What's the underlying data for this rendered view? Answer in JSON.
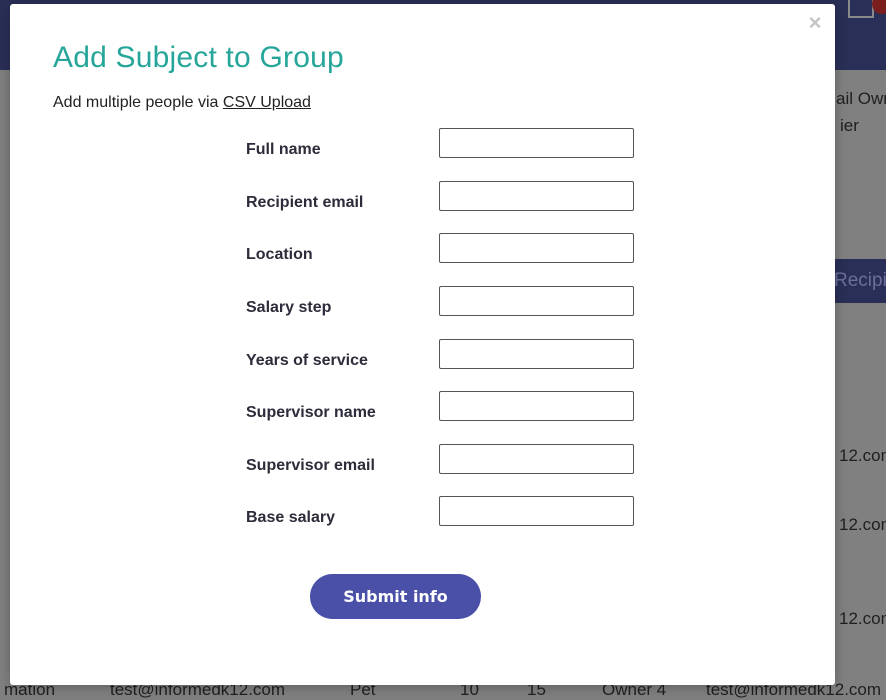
{
  "background": {
    "text_1": "ail Own",
    "text_2": "ier",
    "band_text": "Recipi",
    "text_3": "12.com",
    "text_4": "12.com",
    "text_5": "12.com",
    "row_cells": [
      "mation",
      "test@informedk12.com",
      "Pet",
      "10",
      "15",
      "Owner 4",
      "test@informedk12.com"
    ]
  },
  "modal": {
    "close_label": "×",
    "title": "Add Subject to Group",
    "subtitle_prefix": "Add multiple people via ",
    "csv_link": "CSV Upload",
    "fields": [
      {
        "label": "Full name",
        "value": ""
      },
      {
        "label": "Recipient email",
        "value": ""
      },
      {
        "label": "Location",
        "value": ""
      },
      {
        "label": "Salary step",
        "value": ""
      },
      {
        "label": "Years of service",
        "value": ""
      },
      {
        "label": "Supervisor name",
        "value": ""
      },
      {
        "label": "Supervisor email",
        "value": ""
      },
      {
        "label": "Base salary",
        "value": ""
      }
    ],
    "submit_label": "Submit info"
  }
}
